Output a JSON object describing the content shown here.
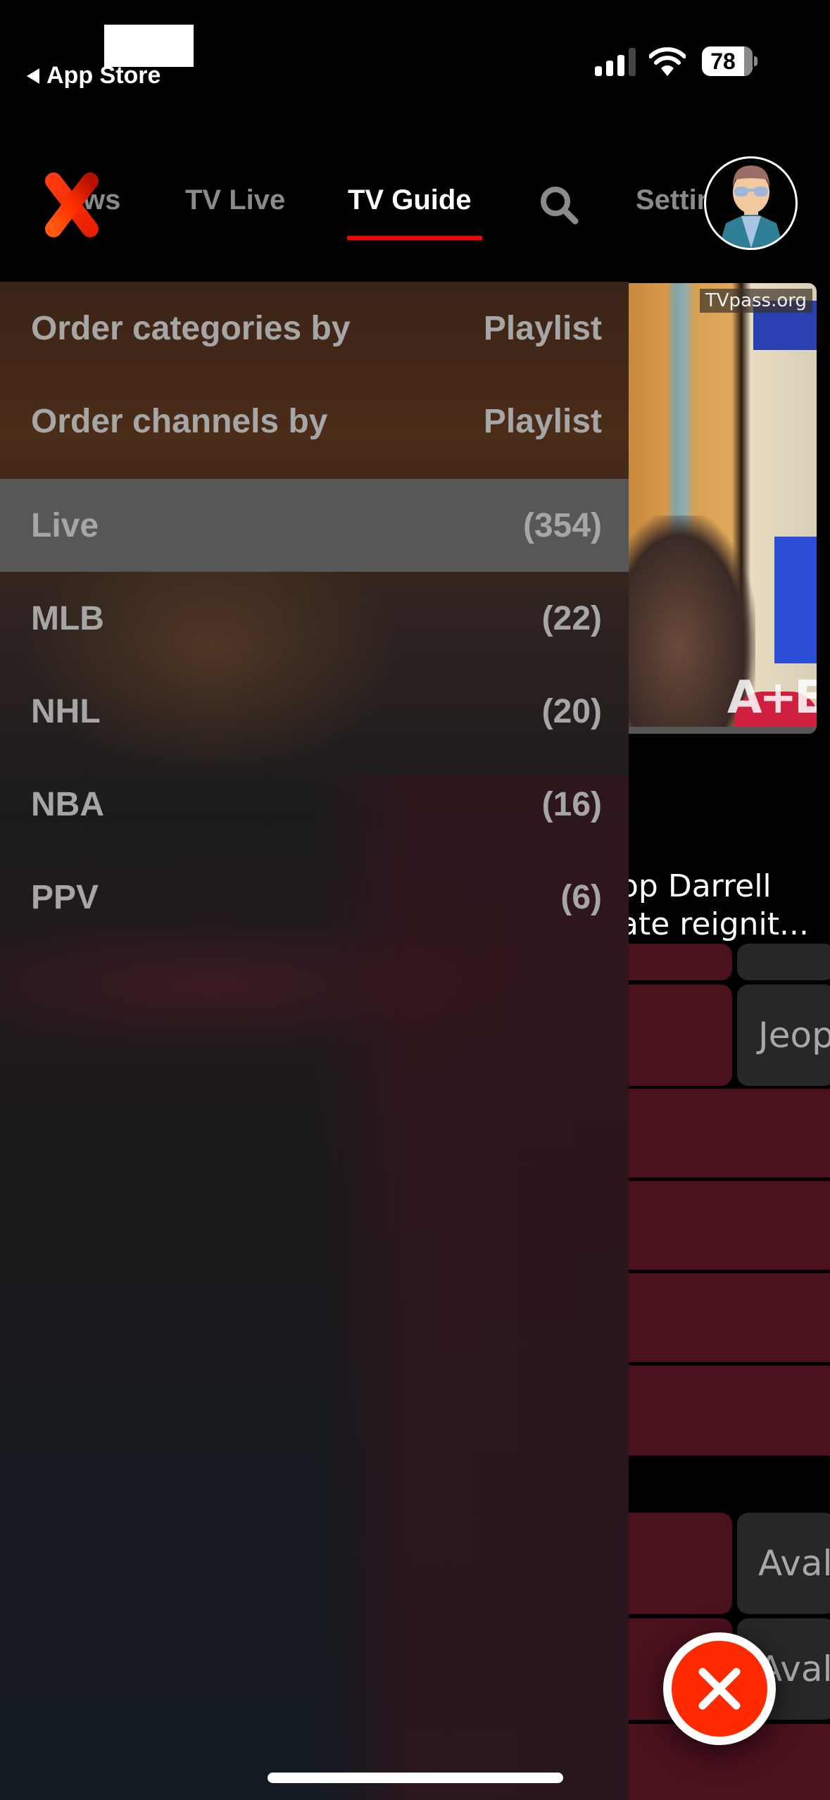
{
  "status_bar": {
    "back_label": "App Store",
    "battery_percent": "78"
  },
  "nav": {
    "tabs": [
      {
        "label": "ws",
        "full_label": "News"
      },
      {
        "label": "TV Live"
      },
      {
        "label": "TV Guide",
        "active": true
      },
      {
        "label": "Setting",
        "full_label": "Settings"
      }
    ],
    "accent_color": "#ff0000"
  },
  "panel": {
    "order_rows": [
      {
        "label": "Order categories by",
        "value": "Playlist"
      },
      {
        "label": "Order channels by",
        "value": "Playlist"
      }
    ],
    "categories": [
      {
        "name": "Live",
        "count": "(354)",
        "selected": true
      },
      {
        "name": "MLB",
        "count": "(22)"
      },
      {
        "name": "NHL",
        "count": "(20)"
      },
      {
        "name": "NBA",
        "count": "(16)"
      },
      {
        "name": "PPV",
        "count": "(6)"
      }
    ]
  },
  "preview": {
    "watermark": "TVpass.org",
    "channel_logo": "A+E",
    "title_line1": "op Darrell",
    "title_line2": "ate reignit..."
  },
  "guide": {
    "programs": [
      "Jeop",
      "Avala",
      "Avala"
    ]
  },
  "colors": {
    "fab": "#ff2a00",
    "guide_cell_red": "#4b111d",
    "guide_cell_dark": "#272727"
  }
}
